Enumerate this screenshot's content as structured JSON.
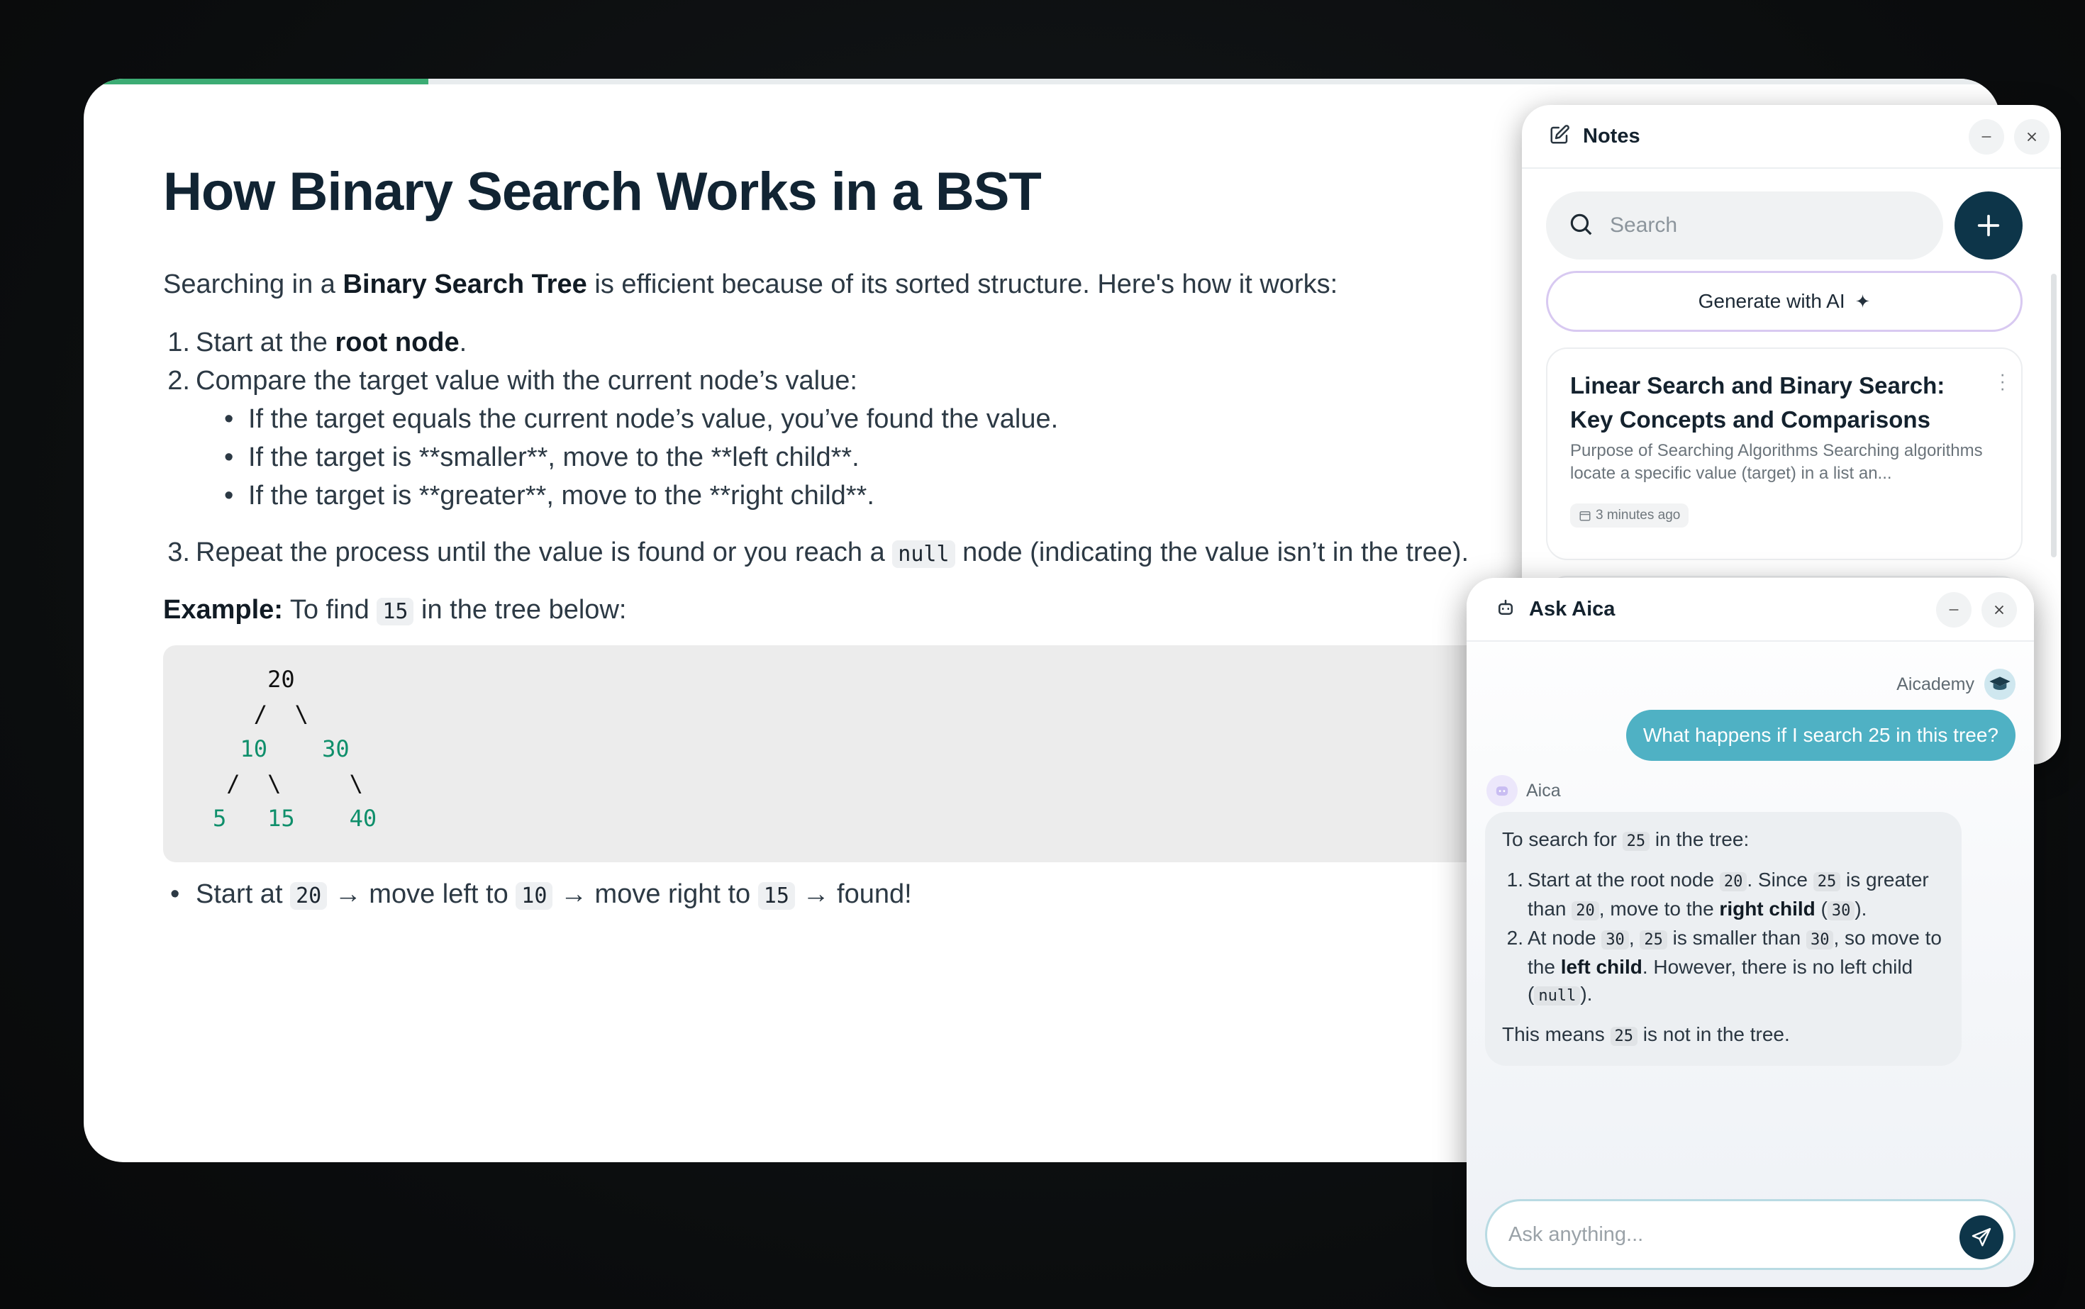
{
  "progress": {
    "percent": 18
  },
  "lesson": {
    "title": "How Binary Search Works in a BST",
    "intro": {
      "before": "Searching in a ",
      "bold": "Binary Search Tree",
      "after": " is efficient because of its sorted structure. Here's how it works:"
    },
    "steps": [
      {
        "num": "1.",
        "before": "Start at the ",
        "bold": "root node",
        "after": "."
      },
      {
        "num": "2.",
        "text": "Compare the target value with the current node’s value:"
      },
      {
        "num": "3.",
        "before": "Repeat the process until the value is found or you reach a ",
        "code": "null",
        "after": " node (indicating the value isn’t in the tree)."
      }
    ],
    "sub_bullets": [
      "If the target equals the current node’s value, you’ve found the value.",
      "If the target is **smaller**, move to the **left child**.",
      "If the target is **greater**, move to the **right child**."
    ],
    "example": {
      "label": "Example:",
      "before": " To find ",
      "code": "15",
      "after": " in the tree below:"
    },
    "tree": {
      "root": "20",
      "level1": [
        "10",
        "30"
      ],
      "level2": [
        "5",
        "15",
        "40"
      ]
    },
    "path": {
      "start": "Start at",
      "v1": "20",
      "arrow1": "→ move left to",
      "v2": "10",
      "arrow2": "→ move right to",
      "v3": "15",
      "end": "→ found!"
    }
  },
  "notes": {
    "title": "Notes",
    "search_placeholder": "Search",
    "generate_label": "Generate with AI",
    "items": [
      {
        "title": "Linear Search and Binary Search: Key Concepts and Comparisons",
        "excerpt": "Purpose of Searching Algorithms Searching algorithms locate a specific value (target) in a list an...",
        "time": "3 minutes ago"
      }
    ]
  },
  "chat": {
    "title": "Ask Aica",
    "user_name": "Aicademy",
    "user_message": "What happens if I search 25 in this tree?",
    "bot_name": "Aica",
    "reply": {
      "intro_before": "To search for ",
      "intro_code": "25",
      "intro_after": " in the tree:",
      "step1_a": "Start at the root node ",
      "step1_c1": "20",
      "step1_b": ". Since ",
      "step1_c2": "25",
      "step1_c": " is greater than ",
      "step1_c3": "20",
      "step1_d": ", move to the ",
      "step1_bold": "right child",
      "step1_e": " (",
      "step1_c4": "30",
      "step1_f": ").",
      "step2_a": "At node ",
      "step2_c1": "30",
      "step2_b": ", ",
      "step2_c2": "25",
      "step2_c": " is smaller than ",
      "step2_c3": "30",
      "step2_d": ", so move to the ",
      "step2_bold": "left child",
      "step2_e": ". However, there is no left child (",
      "step2_c4": "null",
      "step2_f": ").",
      "concl_before": "This means ",
      "concl_code": "25",
      "concl_after": " is not in the tree."
    },
    "input_placeholder": "Ask anything..."
  },
  "colors": {
    "progress": "#3cac74",
    "primary_dark": "#0d3549",
    "user_bubble": "#4fb1c4",
    "tree_green": "#0f8f6b"
  }
}
